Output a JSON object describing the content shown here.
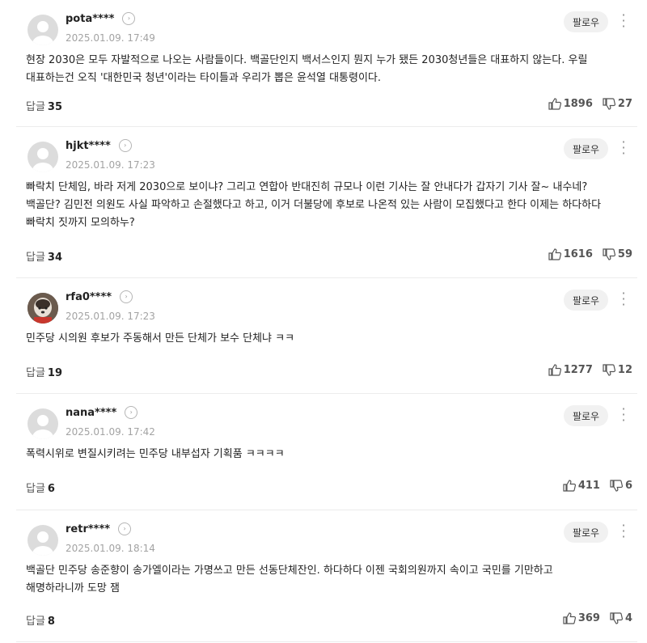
{
  "follow_label": "팔로우",
  "reply_label": "답글",
  "comments": [
    {
      "author": "pota****",
      "date": "2025.01.09. 17:49",
      "text": "현장 2030은 모두 자발적으로 나오는 사람들이다. 백골단인지 백서스인지 뭔지 누가 됐든 2030청년들은 대표하지 않는다. 우릴 대표하는건 오직 '대한민국 청년'이라는 타이틀과 우리가 뽑은 윤석열 대통령이다.",
      "replies": "35",
      "likes": "1896",
      "dislikes": "27"
    },
    {
      "author": "hjkt****",
      "date": "2025.01.09. 17:23",
      "text": "빠락치 단체임, 바라 저게 2030으로 보이냐? 그리고 연합아 반대진히 규모나 이런 기사는 잘 안내다가 갑자기 기사 잘~ 내수네? 백골단? 김민전 의원도 사실 파악하고 손절했다고 하고, 이거 더불당에 후보로 나온적 있는 사람이 모집했다고 한다 이제는 하다하다 빠락치 짓까지 모의하누?",
      "replies": "34",
      "likes": "1616",
      "dislikes": "59"
    },
    {
      "author": "rfa0****",
      "date": "2025.01.09. 17:23",
      "text": "민주당 시의원 후보가 주동해서 만든 단체가 보수 단체냐 ㅋㅋ",
      "replies": "19",
      "likes": "1277",
      "dislikes": "12"
    },
    {
      "author": "nana****",
      "date": "2025.01.09. 17:42",
      "text": "폭력시위로 변질시키려는 민주당 내부섭자 기획품 ㅋㅋㅋㅋ",
      "replies": "6",
      "likes": "411",
      "dislikes": "6"
    },
    {
      "author": "retr****",
      "date": "2025.01.09. 18:14",
      "text": "백골단 민주당 송준향이 송가엘이라는 가명쓰고 만든 선동단체잔인. 하다하다 이젠 국회의원까지 속이고 국민를 기만하고 해명하라니까 도망 잼",
      "replies": "8",
      "likes": "369",
      "dislikes": "4"
    }
  ]
}
